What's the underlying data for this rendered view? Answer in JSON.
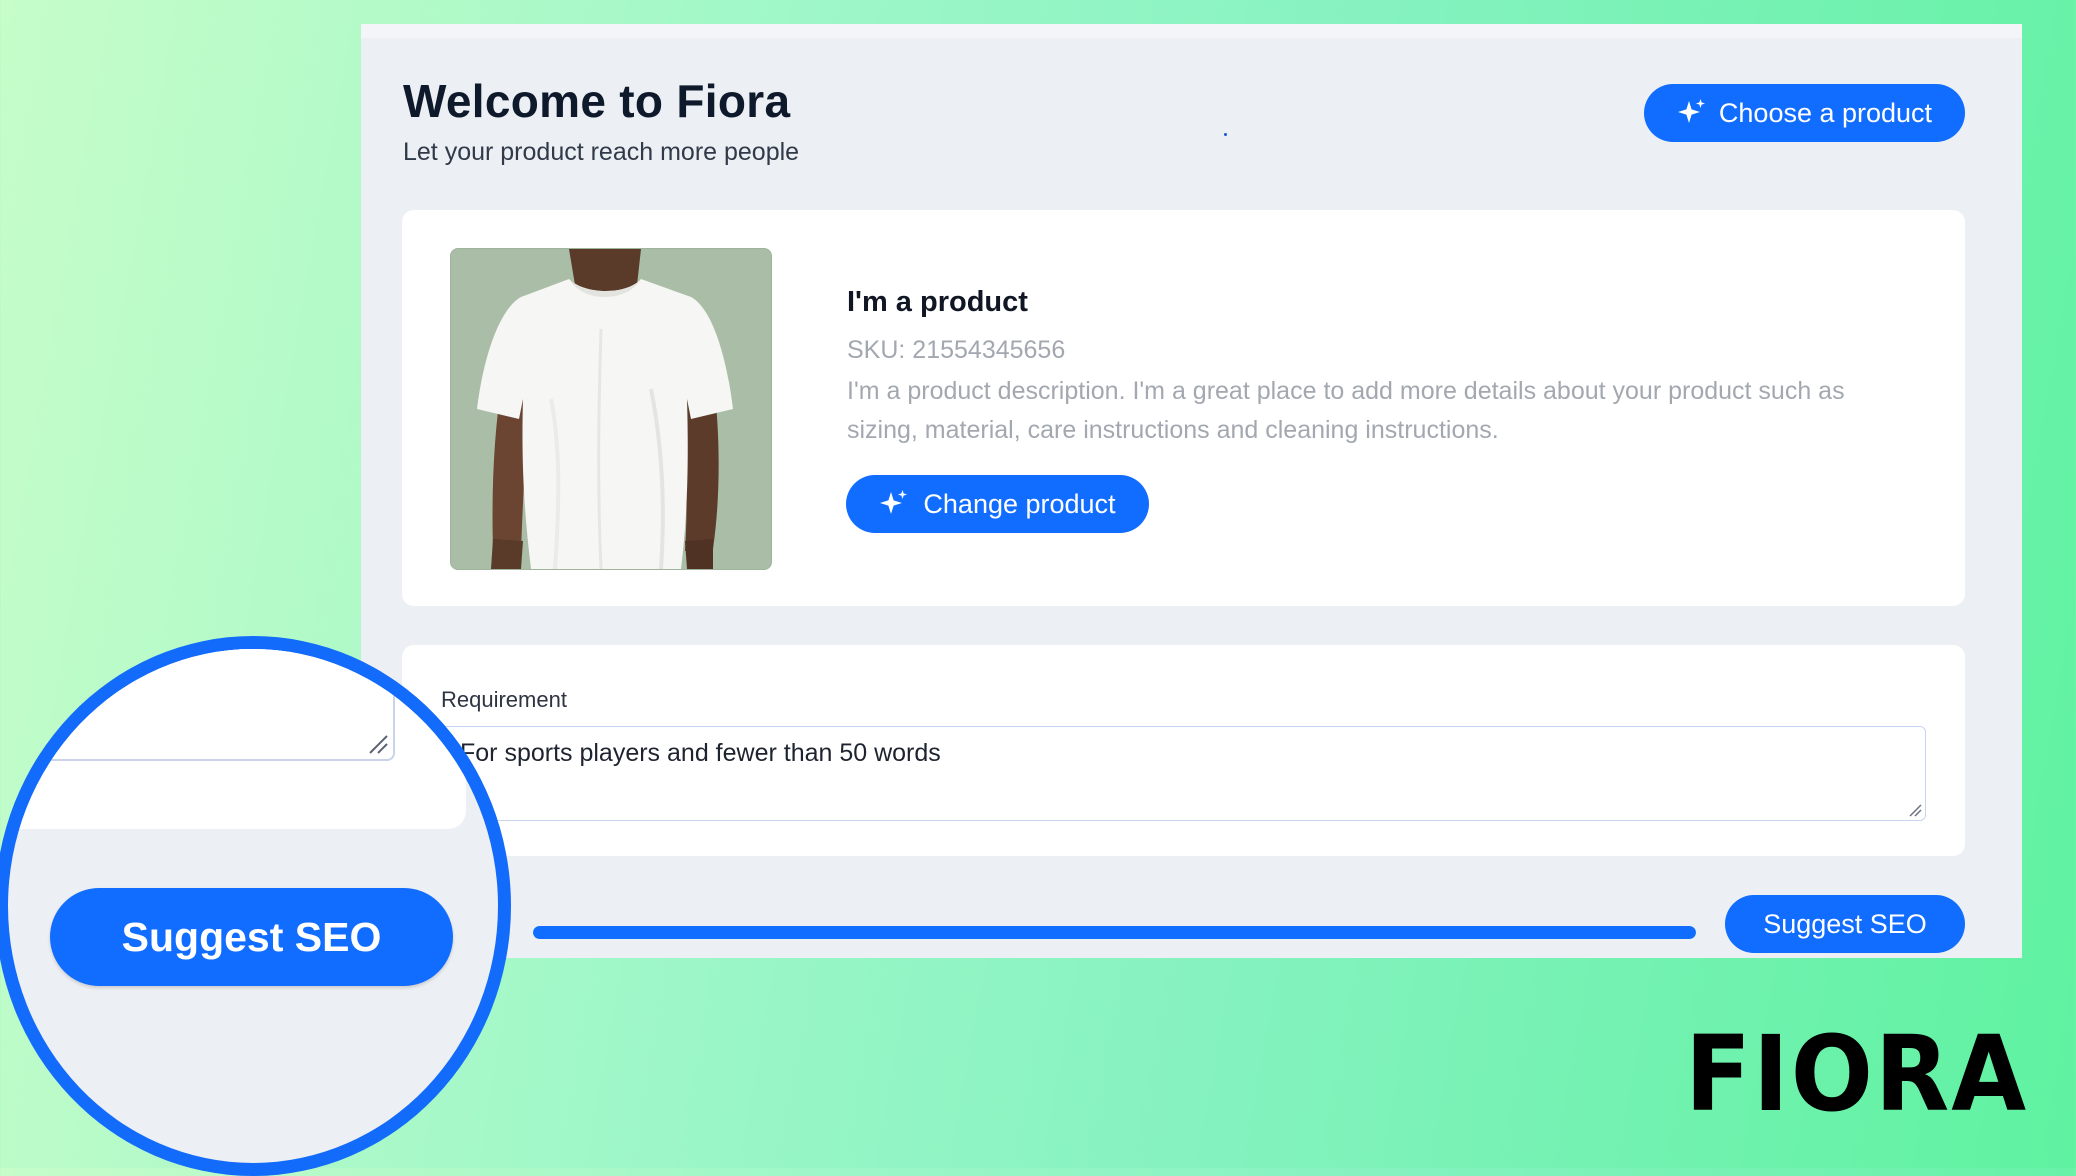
{
  "header": {
    "title": "Welcome to Fiora",
    "subtitle": "Let your product reach more people",
    "choose_label": "Choose a product"
  },
  "product": {
    "name": "I'm a product",
    "sku": "SKU: 21554345656",
    "description": "I'm a product description. I'm a great place to add more details about your product such as sizing, material, care instructions and cleaning instructions.",
    "change_label": "Change product",
    "image_icon": "white-tshirt-photo"
  },
  "requirement": {
    "label": "Requirement",
    "value": "For sports players and fewer than 50 words"
  },
  "progress": {
    "percent": 100
  },
  "actions": {
    "suggest_label": "Suggest SEO"
  },
  "zoom": {
    "suggest_label": "Suggest SEO"
  },
  "brand": {
    "logo_text": "FIORA"
  },
  "colors": {
    "accent": "#116dff",
    "panel": "#eceff3",
    "card": "#ffffff",
    "magnifier_ring": "#126bfb"
  },
  "icons": [
    "sparkle-icon",
    "resize-handle-icon"
  ]
}
